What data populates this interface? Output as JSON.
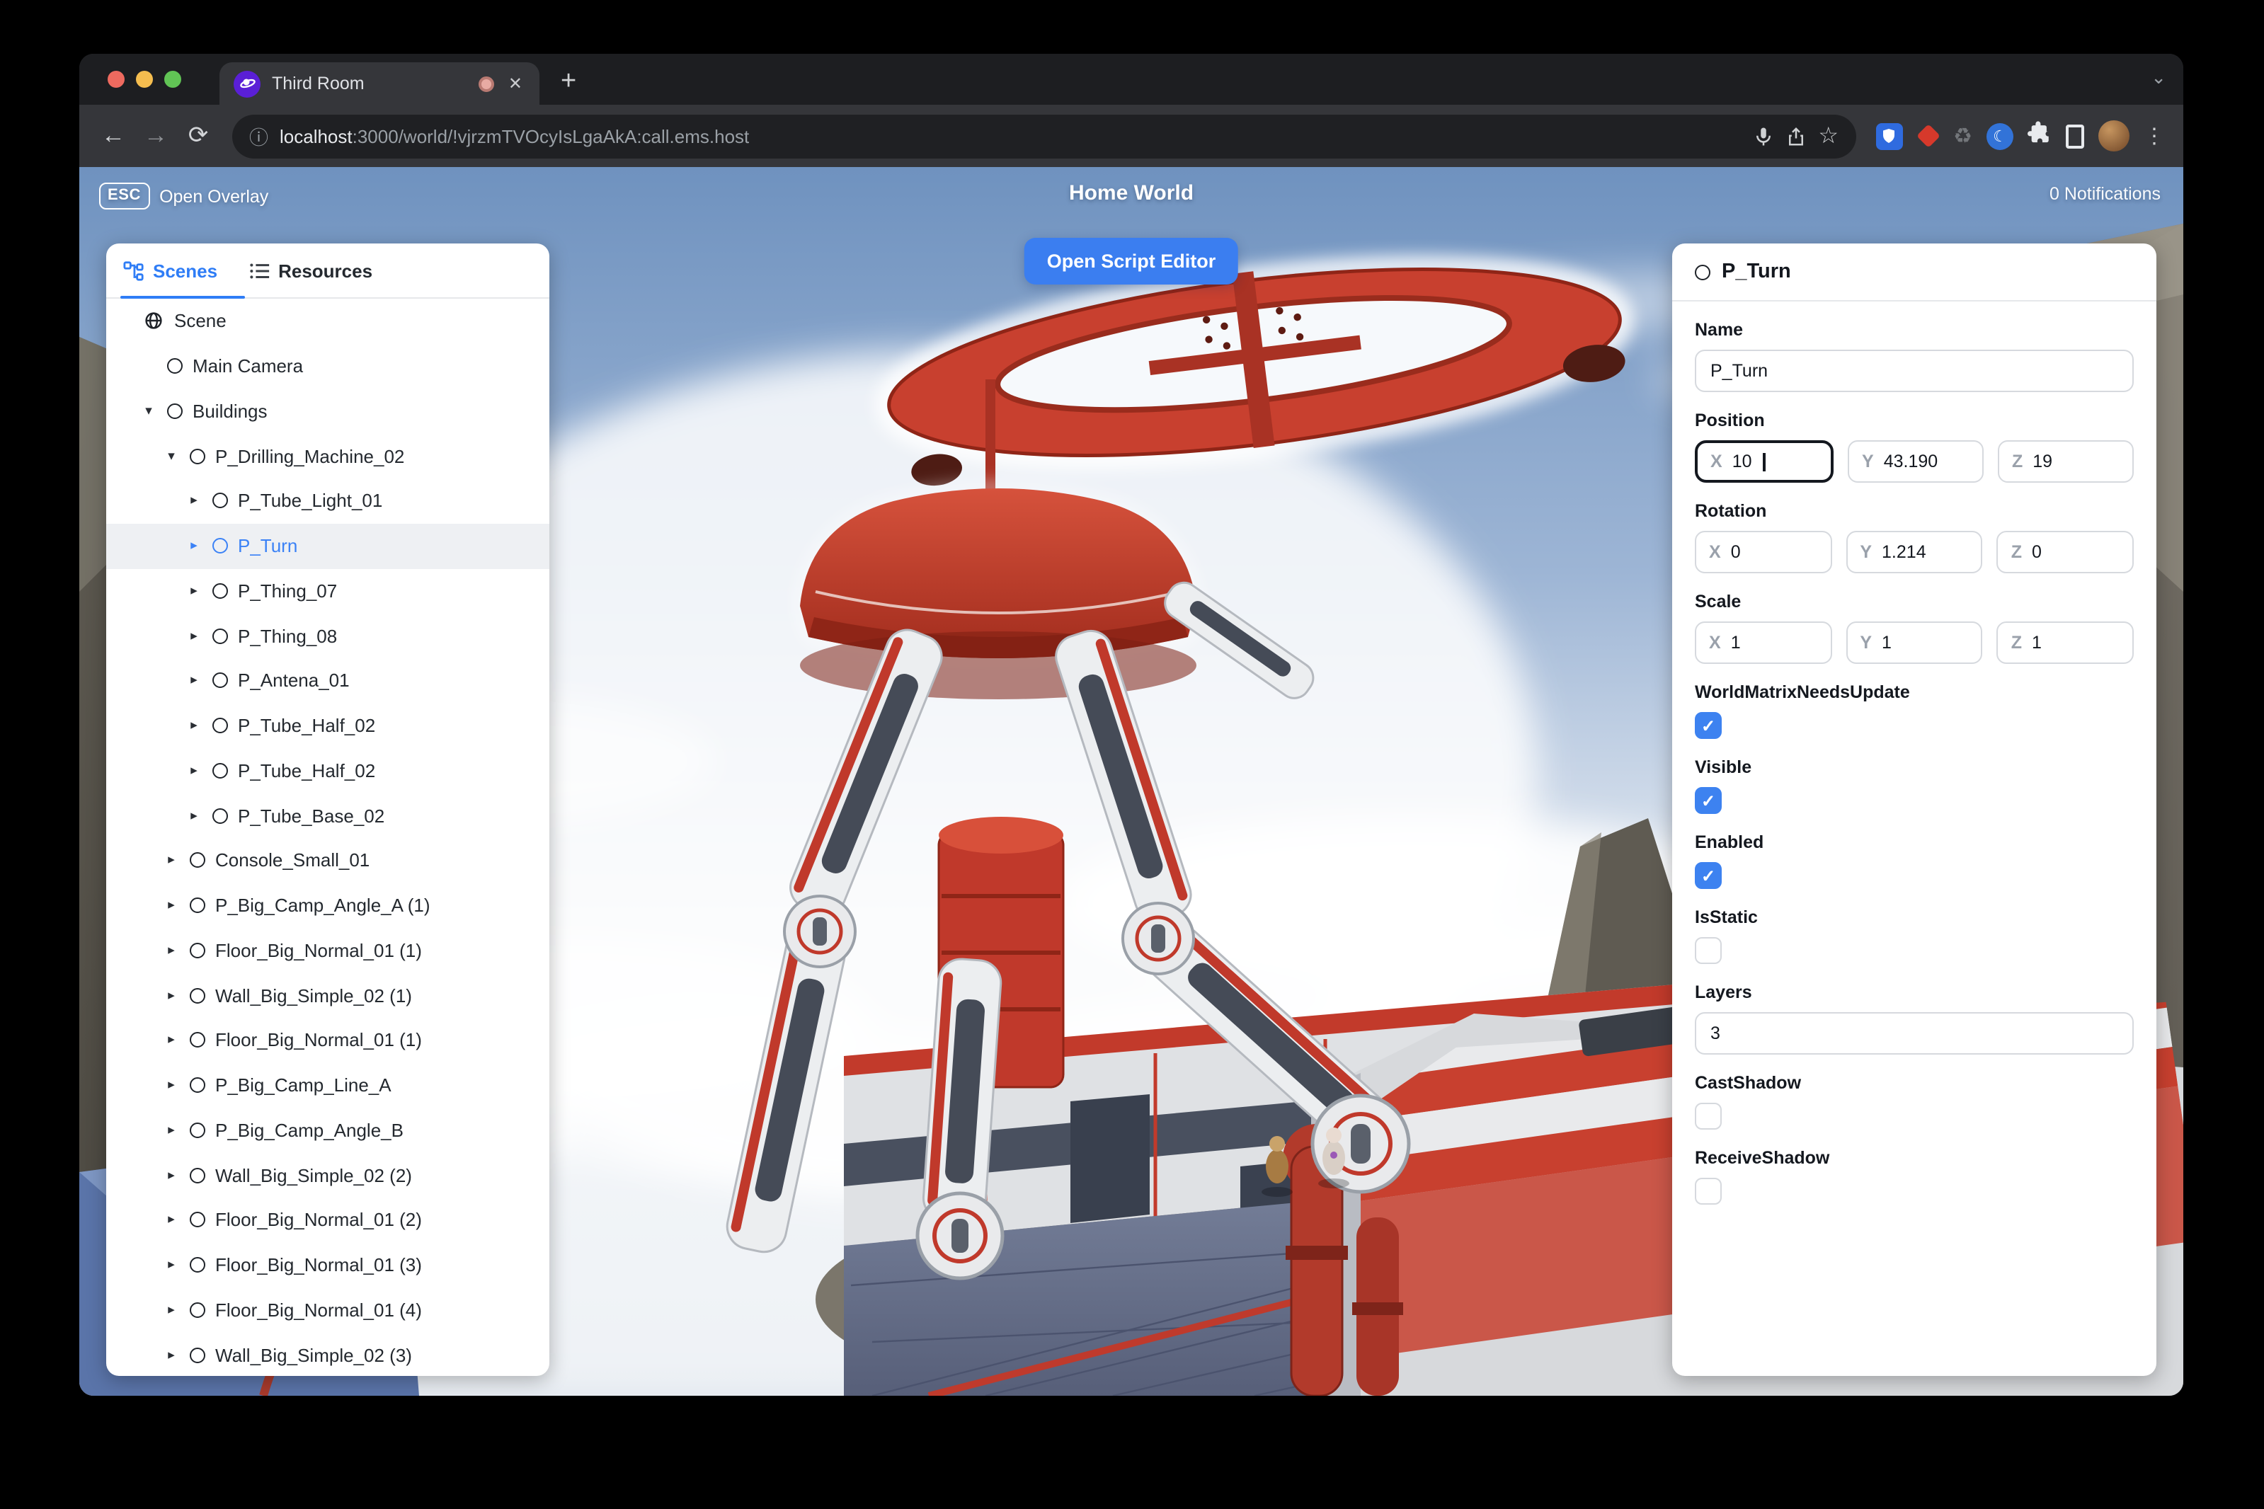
{
  "browser": {
    "tab_title": "Third Room",
    "url_host": "localhost",
    "url_rest": ":3000/world/!vjrzmTVOcyIsLgaAkA:call.ems.host",
    "new_tab_glyph": "+",
    "close_glyph": "✕"
  },
  "overlay": {
    "esc_key": "ESC",
    "open_overlay": "Open Overlay",
    "world_title": "Home World",
    "notifications": "0 Notifications",
    "script_editor_button": "Open Script Editor"
  },
  "left_panel": {
    "tabs": [
      {
        "label": "Scenes",
        "active": true
      },
      {
        "label": "Resources",
        "active": false
      }
    ],
    "tree": [
      {
        "label": "Scene",
        "depth": 0,
        "arrow": "none",
        "icon": "globe"
      },
      {
        "label": "Main Camera",
        "depth": 1,
        "arrow": "none",
        "icon": "circle"
      },
      {
        "label": "Buildings",
        "depth": 1,
        "arrow": "down",
        "icon": "circle"
      },
      {
        "label": "P_Drilling_Machine_02",
        "depth": 2,
        "arrow": "down",
        "icon": "circle"
      },
      {
        "label": "P_Tube_Light_01",
        "depth": 3,
        "arrow": "right",
        "icon": "circle"
      },
      {
        "label": "P_Turn",
        "depth": 3,
        "arrow": "right",
        "icon": "circle",
        "selected": true
      },
      {
        "label": "P_Thing_07",
        "depth": 3,
        "arrow": "right",
        "icon": "circle"
      },
      {
        "label": "P_Thing_08",
        "depth": 3,
        "arrow": "right",
        "icon": "circle"
      },
      {
        "label": "P_Antena_01",
        "depth": 3,
        "arrow": "right",
        "icon": "circle"
      },
      {
        "label": "P_Tube_Half_02",
        "depth": 3,
        "arrow": "right",
        "icon": "circle"
      },
      {
        "label": "P_Tube_Half_02",
        "depth": 3,
        "arrow": "right",
        "icon": "circle"
      },
      {
        "label": "P_Tube_Base_02",
        "depth": 3,
        "arrow": "right",
        "icon": "circle"
      },
      {
        "label": "Console_Small_01",
        "depth": 2,
        "arrow": "right",
        "icon": "circle"
      },
      {
        "label": "P_Big_Camp_Angle_A (1)",
        "depth": 2,
        "arrow": "right",
        "icon": "circle"
      },
      {
        "label": "Floor_Big_Normal_01 (1)",
        "depth": 2,
        "arrow": "right",
        "icon": "circle"
      },
      {
        "label": "Wall_Big_Simple_02 (1)",
        "depth": 2,
        "arrow": "right",
        "icon": "circle"
      },
      {
        "label": "Floor_Big_Normal_01 (1)",
        "depth": 2,
        "arrow": "right",
        "icon": "circle"
      },
      {
        "label": "P_Big_Camp_Line_A",
        "depth": 2,
        "arrow": "right",
        "icon": "circle"
      },
      {
        "label": "P_Big_Camp_Angle_B",
        "depth": 2,
        "arrow": "right",
        "icon": "circle"
      },
      {
        "label": "Wall_Big_Simple_02 (2)",
        "depth": 2,
        "arrow": "right",
        "icon": "circle"
      },
      {
        "label": "Floor_Big_Normal_01 (2)",
        "depth": 2,
        "arrow": "right",
        "icon": "circle"
      },
      {
        "label": "Floor_Big_Normal_01 (3)",
        "depth": 2,
        "arrow": "right",
        "icon": "circle"
      },
      {
        "label": "Floor_Big_Normal_01 (4)",
        "depth": 2,
        "arrow": "right",
        "icon": "circle"
      },
      {
        "label": "Wall_Big_Simple_02 (3)",
        "depth": 2,
        "arrow": "right",
        "icon": "circle"
      }
    ]
  },
  "right_panel": {
    "header": "P_Turn",
    "axis_labels": [
      "X",
      "Y",
      "Z"
    ],
    "sections": [
      {
        "type": "text",
        "label": "Name",
        "value": "P_Turn"
      },
      {
        "type": "vec3",
        "label": "Position",
        "x": "10",
        "y": "43.190",
        "z": "19",
        "focused": "x"
      },
      {
        "type": "vec3",
        "label": "Rotation",
        "x": "0",
        "y": "1.214",
        "z": "0"
      },
      {
        "type": "vec3",
        "label": "Scale",
        "x": "1",
        "y": "1",
        "z": "1"
      },
      {
        "type": "checkbox",
        "label": "WorldMatrixNeedsUpdate",
        "checked": true
      },
      {
        "type": "checkbox",
        "label": "Visible",
        "checked": true
      },
      {
        "type": "checkbox",
        "label": "Enabled",
        "checked": true
      },
      {
        "type": "checkbox",
        "label": "IsStatic",
        "checked": false
      },
      {
        "type": "text",
        "label": "Layers",
        "value": "3"
      },
      {
        "type": "checkbox",
        "label": "CastShadow",
        "checked": false
      },
      {
        "type": "checkbox",
        "label": "ReceiveShadow",
        "checked": false
      }
    ]
  },
  "colors": {
    "accent_blue": "#3b82f6",
    "checkbox_blue": "#3d82f0",
    "button_blue": "#3b7ef0",
    "machine_red": "#c8402f",
    "panel_bg": "#ffffff",
    "chrome_dark": "#1d1e21",
    "toolbar": "#35363a"
  }
}
